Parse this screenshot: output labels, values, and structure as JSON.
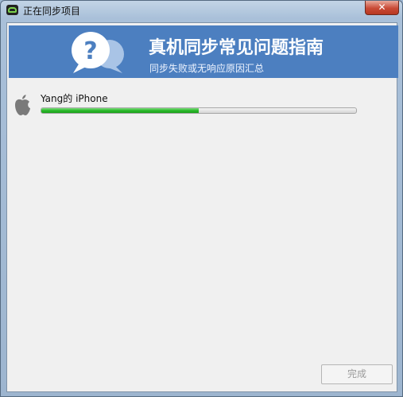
{
  "window": {
    "title": "正在同步项目",
    "close_label": "✕"
  },
  "banner": {
    "title": "真机同步常见问题指南",
    "subtitle": "同步失败或无响应原因汇总",
    "icon_glyph": "?"
  },
  "device": {
    "name": "Yang的 iPhone",
    "progress": 0.5
  },
  "footer": {
    "done_label": "完成"
  },
  "colors": {
    "banner": "#4c7fc0",
    "progress": "#27b827",
    "close": "#c94a36"
  }
}
